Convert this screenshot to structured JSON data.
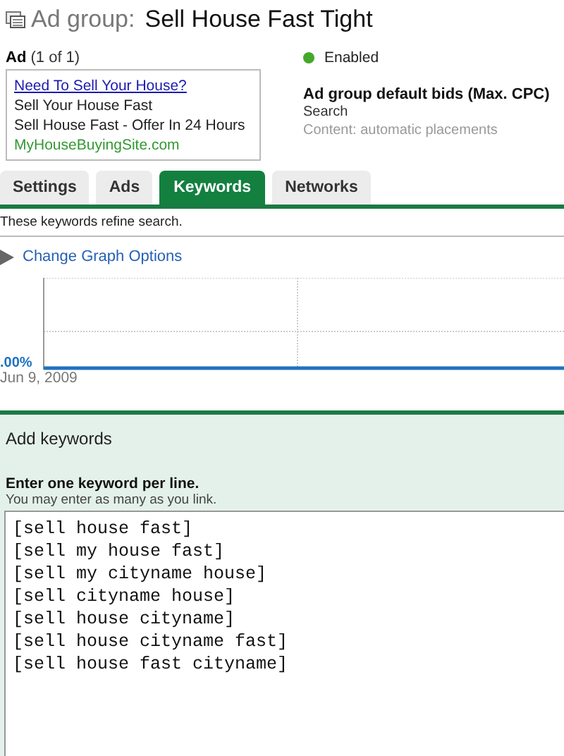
{
  "header": {
    "label": "Ad group:",
    "name": "Sell House Fast Tight"
  },
  "ad": {
    "label": "Ad",
    "count": "(1 of 1)",
    "headline": "Need To Sell Your House?",
    "line1": "Sell Your House Fast",
    "line2": "Sell House Fast - Offer In 24 Hours",
    "url": "MyHouseBuyingSite.com"
  },
  "status": "Enabled",
  "bids": {
    "title": "Ad group default bids (Max. CPC)",
    "rows": [
      "Search",
      "Content: automatic placements"
    ]
  },
  "tabs": [
    {
      "label": "Settings",
      "selected": false
    },
    {
      "label": "Ads",
      "selected": false
    },
    {
      "label": "Keywords",
      "selected": true
    },
    {
      "label": "Networks",
      "selected": false
    }
  ],
  "description": "These keywords refine search.",
  "graph_options": "Change Graph Options",
  "graph": {
    "y_label": ".00%",
    "x_label": "Jun 9, 2009"
  },
  "add_keywords": {
    "title": "Add keywords",
    "instruction": "Enter one keyword per line.",
    "hint": "You may enter as many as you link.",
    "keywords": [
      "[sell house fast]",
      "[sell my house fast]",
      "[sell my cityname house]",
      "[sell cityname house]",
      "[sell house cityname]",
      "[sell house cityname fast]",
      "[sell house fast cityname]"
    ]
  }
}
